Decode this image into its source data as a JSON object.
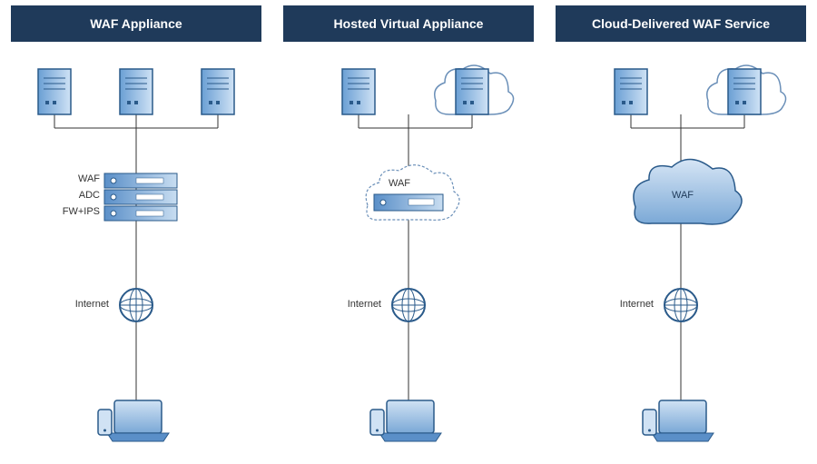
{
  "columns": [
    {
      "title": "WAF Appliance",
      "stack_labels": [
        "WAF",
        "ADC",
        "FW+IPS"
      ],
      "internet_label": "Internet",
      "waf_label": ""
    },
    {
      "title": "Hosted Virtual Appliance",
      "stack_labels": [],
      "internet_label": "Internet",
      "waf_label": "WAF"
    },
    {
      "title": "Cloud-Delivered WAF Service",
      "stack_labels": [],
      "internet_label": "Internet",
      "waf_label": "WAF"
    }
  ]
}
